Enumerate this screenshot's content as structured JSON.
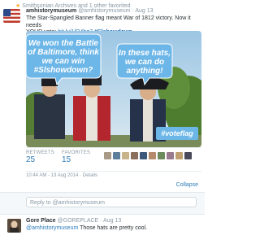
{
  "context": {
    "text": "Smithsonian Archives and 1 other favorited"
  },
  "tweet": {
    "display_name": "amhistorymuseum",
    "handle": "@amhistorymuseum",
    "date": "· Aug 13",
    "text_line1": "The Star-Spangled Banner flag meant War of 1812 victory. Now it needs",
    "text_line2_prefix": "YOUR vote:",
    "link": "bit.ly/1lO4bq7",
    "hashtag": "#Slshowdown"
  },
  "photo": {
    "bubble_left": [
      "We won the Battle",
      "of Baltimore, think",
      "we can win",
      "#Slshowdown?"
    ],
    "bubble_right": [
      "In these hats,",
      "we can do",
      "anything!"
    ],
    "tag": "#voteflag"
  },
  "stats": {
    "retweets_label": "RETWEETS",
    "retweets_count": "25",
    "favorites_label": "FAVORITES",
    "favorites_count": "15"
  },
  "timestamp": {
    "text": "10:44 AM - 13 Aug 2014 ·",
    "details": "Details"
  },
  "collapse_label": "Collapse",
  "reply": {
    "placeholder": "Reply to @amhistorymuseum"
  },
  "reply_tweet": {
    "display_name": "Gore Place",
    "handle": "@GOREPLACE",
    "date": "· Aug 13",
    "mention": "@amhistorymuseum",
    "text": "Those hats are pretty cool."
  },
  "colors": {
    "link": "#2b7bb9",
    "muted": "#8899a6",
    "bubble": "#6cb6e8"
  }
}
